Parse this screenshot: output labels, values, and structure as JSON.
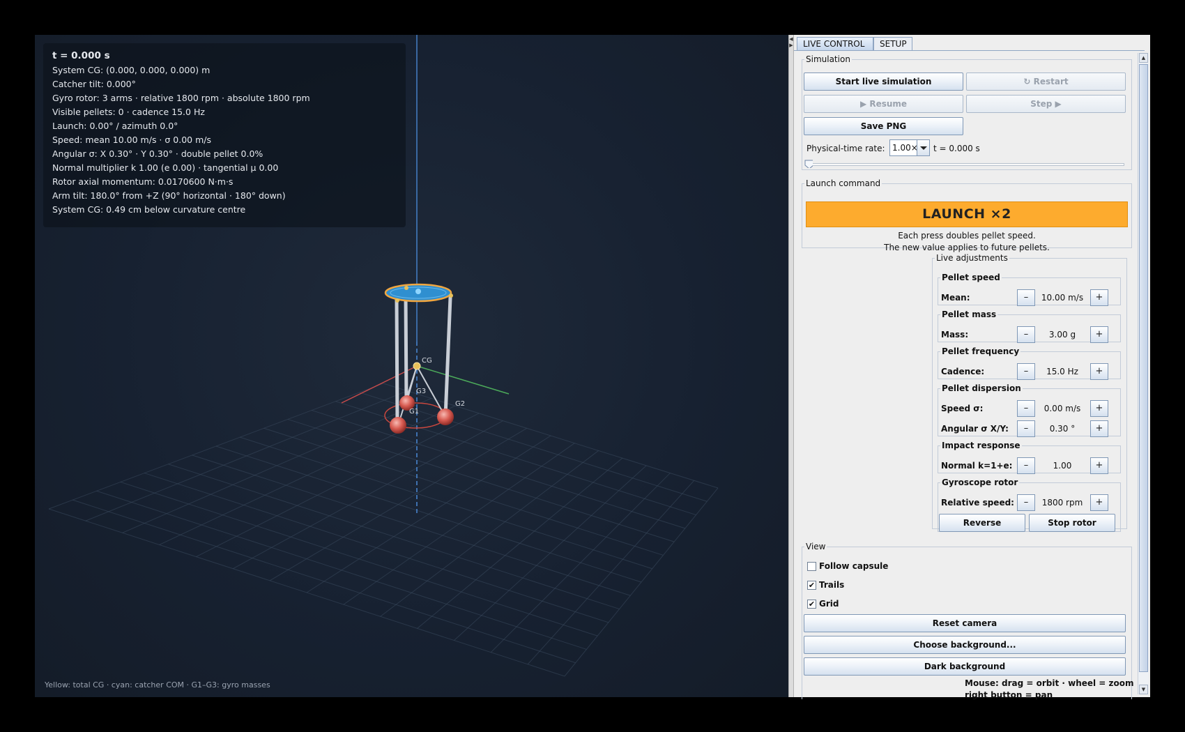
{
  "hud": {
    "time": "t = 0.000 s",
    "lines": [
      "System CG: (0.000, 0.000, 0.000) m",
      "Catcher tilt: 0.000°",
      "Gyro rotor: 3 arms · relative 1800 rpm · absolute 1800 rpm",
      "Visible pellets: 0 · cadence 15.0 Hz",
      "Launch: 0.00° / azimuth 0.0°",
      "Speed: mean 10.00 m/s · σ 0.00 m/s",
      "Angular σ: X 0.30° · Y 0.30° · double pellet 0.0%",
      "Normal multiplier k 1.00 (e 0.00) · tangential μ 0.00",
      "Rotor axial momentum: 0.0170600 N·m·s",
      "Arm tilt: 180.0° from +Z (90° horizontal · 180° down)",
      "System CG: 0.49 cm below curvature centre"
    ]
  },
  "scene": {
    "labels": {
      "cg": "CG",
      "g1": "G1",
      "g2": "G2",
      "g3": "G3"
    },
    "legend_note": "Yellow: total CG · cyan: catcher COM · G1–G3: gyro masses",
    "colors": {
      "cg": "#e8c15a",
      "catcher": "#3aa0e0",
      "gyro": "#e0625a",
      "x_axis": "#c64b4b",
      "y_axis": "#4caa5a",
      "z_axis": "#4a8ad8"
    }
  },
  "tabs": {
    "live": "LIVE CONTROL",
    "setup": "SETUP"
  },
  "simulation": {
    "title": "Simulation",
    "start": "Start live simulation",
    "restart": "↻ Restart",
    "resume": "▶ Resume",
    "step": "Step ▶",
    "save_png": "Save PNG",
    "rate_label": "Physical-time rate:",
    "rate_value": "1.00×",
    "time": "t = 0.000 s"
  },
  "launch": {
    "title": "Launch command",
    "button": "LAUNCH ×2",
    "note1": "Each press doubles pellet speed.",
    "note2": "The new value applies to future pellets."
  },
  "adjust": {
    "title": "Live adjustments",
    "minus": "–",
    "plus": "+",
    "pellet_speed": {
      "title": "Pellet speed",
      "label": "Mean:",
      "value": "10.00 m/s"
    },
    "pellet_mass": {
      "title": "Pellet mass",
      "label": "Mass:",
      "value": "3.00 g"
    },
    "pellet_freq": {
      "title": "Pellet frequency",
      "label": "Cadence:",
      "value": "15.0 Hz"
    },
    "dispersion": {
      "title": "Pellet dispersion",
      "speed_label": "Speed σ:",
      "speed_value": "0.00 m/s",
      "ang_label": "Angular σ X/Y:",
      "ang_value": "0.30 °"
    },
    "impact": {
      "title": "Impact response",
      "label": "Normal k=1+e:",
      "value": "1.00"
    },
    "rotor": {
      "title": "Gyroscope rotor",
      "label": "Relative speed:",
      "value": "1800 rpm",
      "reverse": "Reverse",
      "stop": "Stop rotor"
    }
  },
  "view": {
    "title": "View",
    "follow": {
      "label": "Follow capsule",
      "checked": false
    },
    "trails": {
      "label": "Trails",
      "checked": true
    },
    "grid": {
      "label": "Grid",
      "checked": true
    },
    "reset": "Reset camera",
    "choose_bg": "Choose background...",
    "dark_bg": "Dark background",
    "hint1": "Mouse: drag = orbit · wheel = zoom",
    "hint2": "right button = pan"
  }
}
